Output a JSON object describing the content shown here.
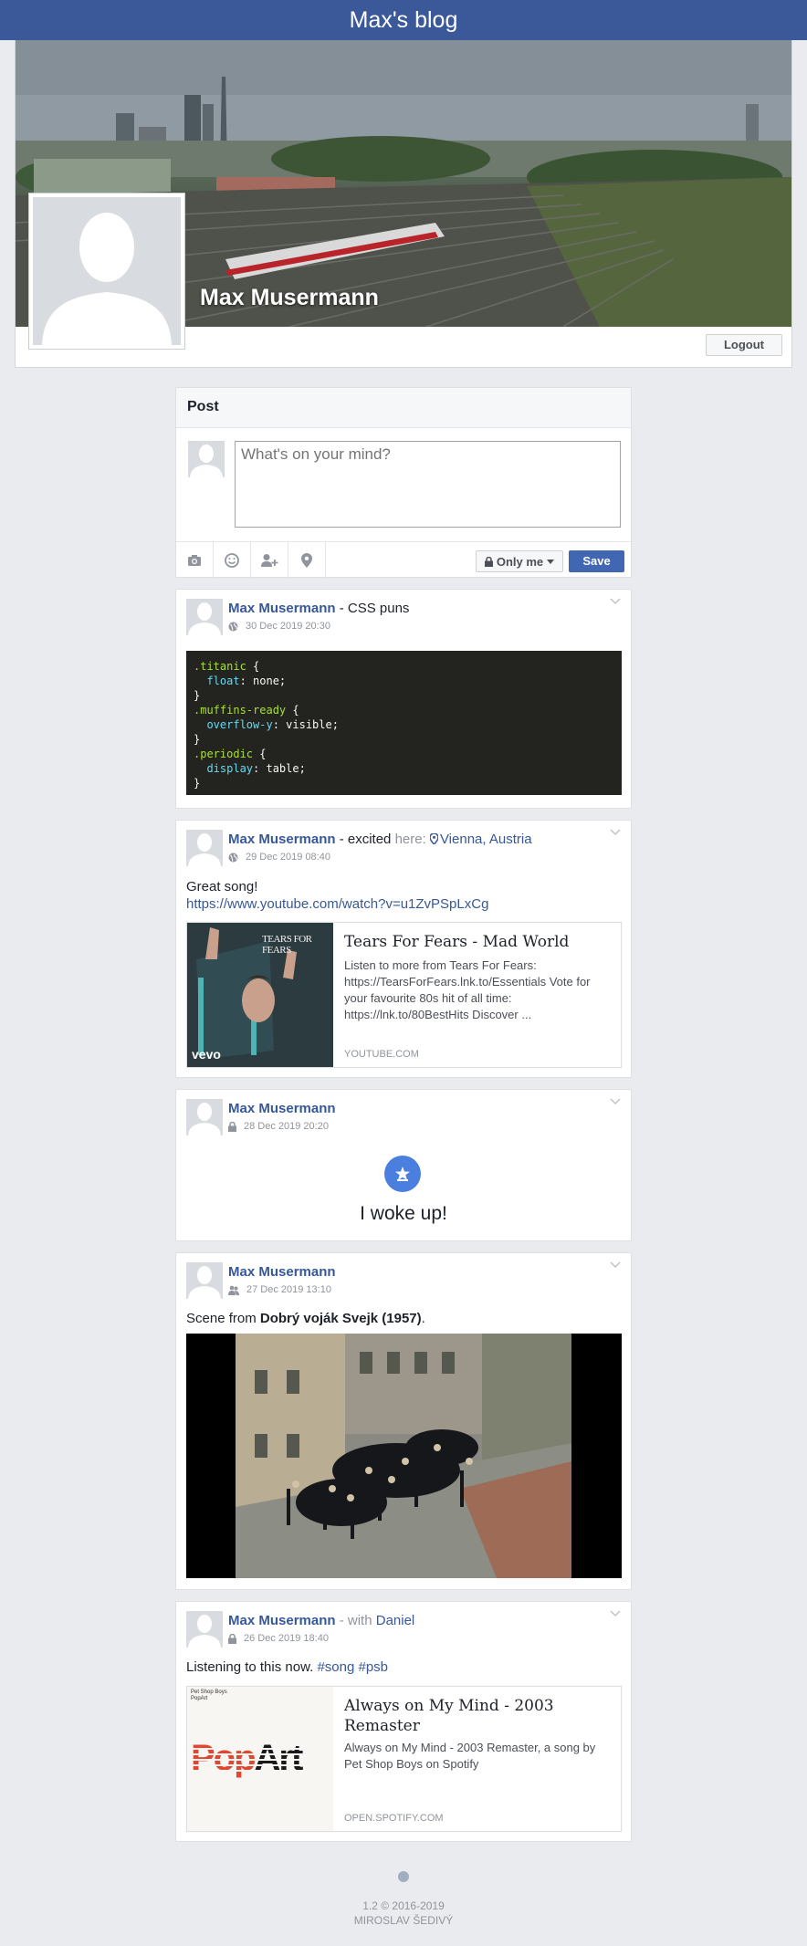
{
  "app": {
    "title": "Max's blog"
  },
  "profile": {
    "name": "Max Musermann",
    "logout_label": "Logout"
  },
  "composer": {
    "heading": "Post",
    "placeholder": "What's on your mind?",
    "tools": [
      "camera-icon",
      "smiley-icon",
      "tag-person-icon",
      "location-icon"
    ],
    "privacy_label": "Only me",
    "save_label": "Save"
  },
  "posts": [
    {
      "author": "Max Musermann",
      "separator": " - ",
      "title": "CSS puns",
      "date": "30 Dec 2019 20:30",
      "privacy_icon": "globe-icon",
      "code": {
        "l1_sel": ".titanic",
        "l1_rest": " {",
        "l2_prop": "float",
        "l2_rest": ": none;",
        "l3": "}",
        "l4_sel": ".muffins-ready",
        "l4_rest": " {",
        "l5_prop": "overflow-y",
        "l5_rest": ": visible;",
        "l6": "}",
        "l7_sel": ".periodic",
        "l7_rest": " {",
        "l8_prop": "display",
        "l8_rest": ": table;",
        "l9": "}"
      }
    },
    {
      "author": "Max Musermann",
      "feeling": " - excited",
      "here_label": " here: ",
      "location": "Vienna, Austria",
      "date": "29 Dec 2019 08:40",
      "privacy_icon": "globe-icon",
      "text": "Great song!",
      "url": "https://www.youtube.com/watch?v=u1ZvPSpLxCg",
      "link": {
        "thumb_text": "TEARS FOR FEARS",
        "thumb_badge": "vevo",
        "title": "Tears For Fears - Mad World",
        "description": "Listen to more from Tears For Fears: https://TearsForFears.lnk.to/Essentials Vote for your favourite 80s hit of all time: https://lnk.to/80BestHits Discover ...",
        "domain": "YOUTUBE.COM"
      }
    },
    {
      "author": "Max Musermann",
      "date": "28 Dec 2019 20:20",
      "privacy_icon": "lock-icon",
      "event_icon": "star-icon",
      "event_text": "I woke up!"
    },
    {
      "author": "Max Musermann",
      "date": "27 Dec 2019 13:10",
      "privacy_icon": "friends-icon",
      "text_prefix": "Scene from ",
      "text_bold": "Dobrý voják Svejk (1957)",
      "text_suffix": "."
    },
    {
      "author": "Max Musermann",
      "with_label": " - with ",
      "with_name": "Daniel",
      "date": "26 Dec 2019 18:40",
      "privacy_icon": "lock-icon",
      "text_prefix": "Listening to this now. ",
      "hashtag1": "#song",
      "hashtag2": "#psb",
      "link": {
        "thumb_small_line1": "Pet Shop Boys",
        "thumb_small_line2": "PopArt",
        "thumb_word_pop": "Pop",
        "thumb_word_art": "Art",
        "title": "Always on My Mind - 2003 Remaster",
        "description": "Always on My Mind - 2003 Remaster, a song by Pet Shop Boys on Spotify",
        "domain": "OPEN.SPOTIFY.COM"
      }
    }
  ],
  "footer": {
    "version": "1.2 © 2016-2019",
    "author": "MIROSLAV ŠEDIVÝ"
  },
  "colors": {
    "brand": "#3b5998",
    "link": "#365899",
    "save": "#4267b2"
  }
}
